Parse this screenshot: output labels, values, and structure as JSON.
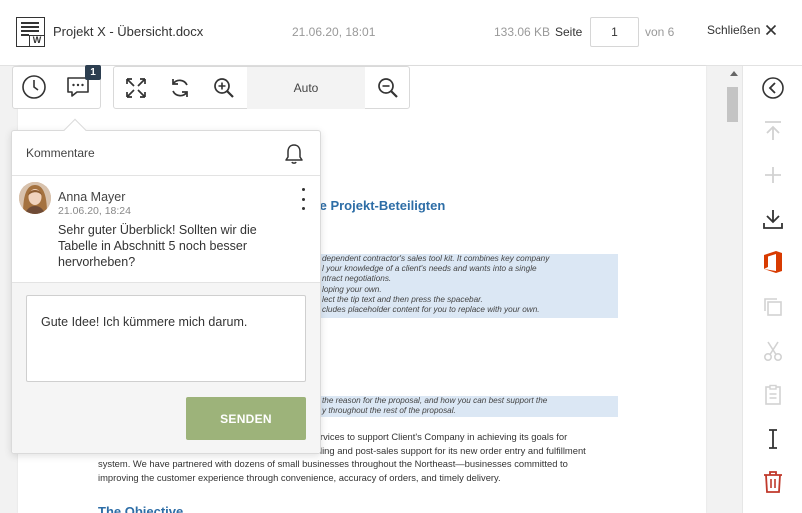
{
  "header": {
    "file_name": "Projekt X - Übersicht.docx",
    "file_date": "21.06.20, 18:01",
    "file_size": "133.06 KB",
    "page_label": "Seite",
    "page_value": "1",
    "of_label": "von 6",
    "close_label": "Schließen",
    "doc_badge": "W"
  },
  "toolbar": {
    "comment_count": "1",
    "zoom_label": "Auto"
  },
  "comments": {
    "title": "Kommentare",
    "items": [
      {
        "author": "Anna Mayer",
        "date": "21.06.20, 18:24",
        "text": "Sehr guter Überblick! Sollten wir die Tabelle in Abschnitt 5 noch besser hervorheben?"
      }
    ],
    "reply_value": "Gute Idee! Ich kümmere mich darum.",
    "send_label": "SENDEN"
  },
  "document": {
    "heading": "le Projekt-Beteiligten",
    "highlight1": [
      "dependent contractor's sales tool kit. It combines key company",
      "l your knowledge of a client's needs and wants into a single",
      "ntract negotiations.",
      "loping your own.",
      "lect the tip text and then press the spacebar.",
      "cludes placeholder content for you to replace with your own."
    ],
    "highlight2": [
      "the reason for the proposal, and how you can best support the",
      "y throughout the rest of the proposal."
    ],
    "body": [
      "rvices to support Client's Company in achieving its goals for",
      "ling and post-sales support for its new order entry and fulfillment",
      "system. We have partnered with dozens of small businesses throughout the Northeast—businesses committed to",
      "improving the customer experience through convenience, accuracy of orders, and timely delivery."
    ],
    "heading2": "The Objective"
  },
  "colors": {
    "accent": "#2d6da6",
    "send": "#9db37a",
    "badge": "#2c3e50",
    "office": "#d83b01",
    "delete": "#c0392b"
  },
  "icons": {
    "history": "clock-icon",
    "comments": "comment-icon",
    "fullscreen": "expand-icon",
    "rotate": "rotate-icon",
    "zoom_in": "zoom-in-icon",
    "zoom_out": "zoom-out-icon",
    "back": "chevron-left-circle-icon",
    "notify": "bell-icon"
  }
}
